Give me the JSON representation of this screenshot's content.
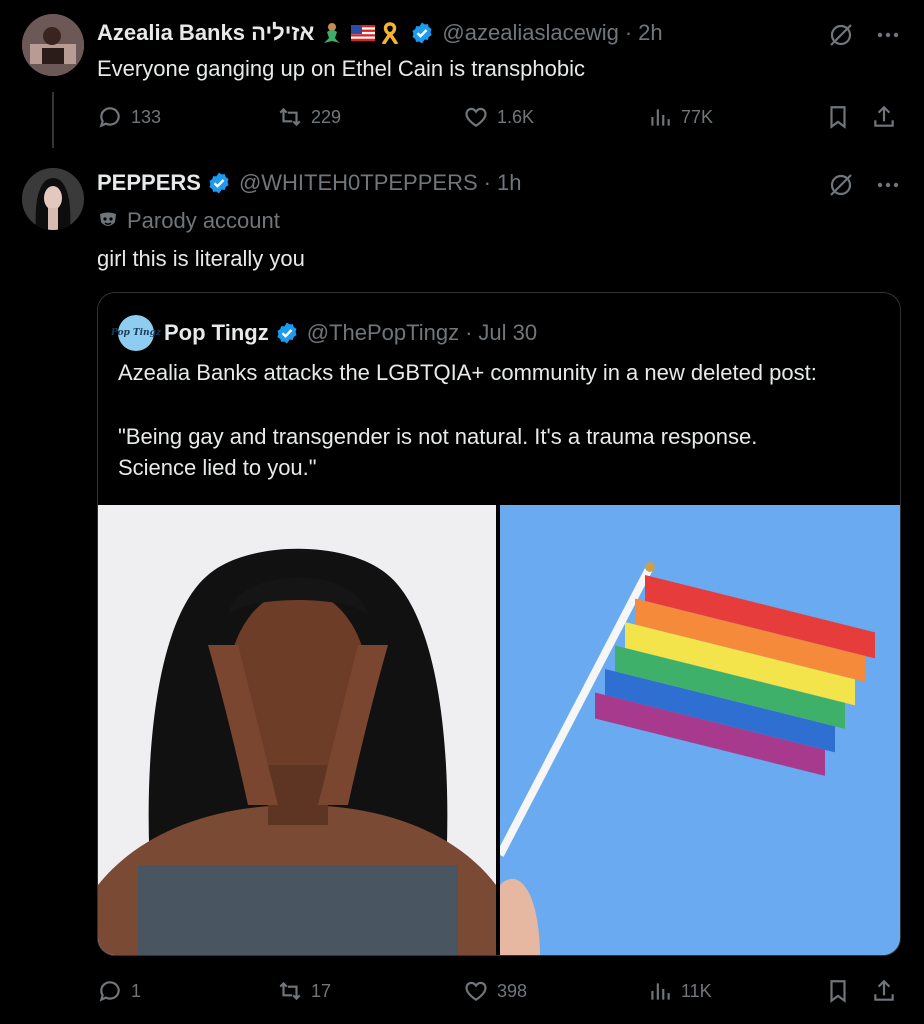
{
  "tweet1": {
    "name": "Azealia Banks אזיליה",
    "emoji": [
      "mermaid-emoji",
      "us-flag-emoji",
      "ribbon-emoji"
    ],
    "handle": "@azealiaslacewig",
    "time": "2h",
    "text": "Everyone ganging up on Ethel Cain is transphobic",
    "replies": "133",
    "reposts": "229",
    "likes": "1.6K",
    "views": "77K"
  },
  "tweet2": {
    "name": "PEPPERS",
    "handle": "@WHITEH0TPEPPERS",
    "time": "1h",
    "parody_label": "Parody account",
    "text": "girl this is literally you",
    "replies": "1",
    "reposts": "17",
    "likes": "398",
    "views": "11K"
  },
  "quote": {
    "name": "Pop Tingz",
    "avatar_text": "Pop Tingz",
    "handle": "@ThePopTingz",
    "date": "Jul 30",
    "line1": "Azealia Banks attacks the LGBTQIA+ community in a new deleted post:",
    "line2": "\"Being gay and transgender is not natural. It's a trauma response.",
    "line3": "Science lied to you.\""
  },
  "colors": {
    "background": "#000000",
    "text": "#e7e9ea",
    "muted": "#71767b",
    "verified": "#1d9bf0",
    "border": "#2f3336"
  },
  "icons": [
    "reply-icon",
    "repost-icon",
    "like-icon",
    "views-icon",
    "bookmark-icon",
    "share-icon",
    "grok-icon",
    "more-icon",
    "verified-icon",
    "parody-mask-icon"
  ]
}
